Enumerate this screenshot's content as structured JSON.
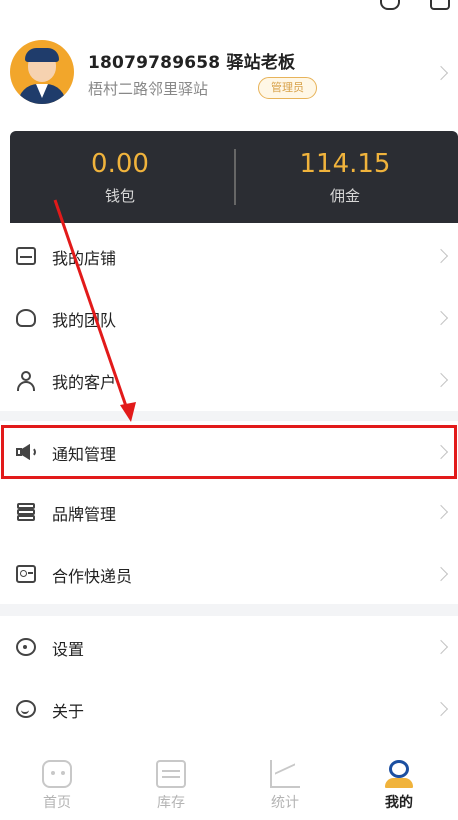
{
  "profile": {
    "name": "18079789658 驿站老板",
    "station": "梧村二路邻里驿站",
    "role_badge": "管理员"
  },
  "wallet": {
    "balance_value": "0.00",
    "balance_label": "钱包",
    "commission_value": "114.15",
    "commission_label": "佣金"
  },
  "menu": {
    "group1": [
      {
        "label": "我的店铺",
        "icon": "store-icon"
      },
      {
        "label": "我的团队",
        "icon": "team-icon"
      },
      {
        "label": "我的客户",
        "icon": "user-icon"
      }
    ],
    "group2": [
      {
        "label": "通知管理",
        "icon": "speaker-icon"
      },
      {
        "label": "品牌管理",
        "icon": "layers-icon"
      },
      {
        "label": "合作快递员",
        "icon": "id-card-icon"
      }
    ],
    "group3": [
      {
        "label": "设置",
        "icon": "gear-icon"
      },
      {
        "label": "关于",
        "icon": "info-icon"
      }
    ]
  },
  "nav": {
    "tabs": [
      {
        "label": "首页",
        "icon": "home-icon"
      },
      {
        "label": "库存",
        "icon": "inventory-icon"
      },
      {
        "label": "统计",
        "icon": "stats-icon"
      },
      {
        "label": "我的",
        "icon": "profile-icon",
        "active": true
      }
    ]
  },
  "colors": {
    "accent": "#f0b33c",
    "highlight": "#e21a1a",
    "wallet_bg": "#2b2d33",
    "active_tab": "#1c4fa0"
  }
}
